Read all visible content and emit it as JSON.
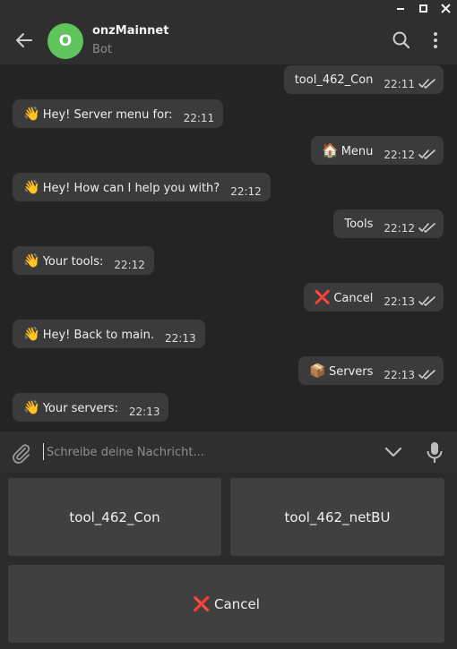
{
  "window": {
    "minimize_icon": "minimize-icon",
    "maximize_icon": "maximize-icon",
    "close_icon": "close-icon"
  },
  "header": {
    "avatar_letter": "O",
    "title": "onzMainnet",
    "subtitle": "Bot",
    "avatar_color": "#5fc45b"
  },
  "messages": [
    {
      "dir": "out",
      "emoji": "",
      "text": "tool_462_Con",
      "time": "22:11",
      "read": true
    },
    {
      "dir": "in",
      "emoji": "👋",
      "text": "Hey! Server menu for:",
      "time": "22:11"
    },
    {
      "dir": "out",
      "emoji": "🏠",
      "text": "Menu",
      "time": "22:12",
      "read": true
    },
    {
      "dir": "in",
      "emoji": "👋",
      "text": "Hey! How can I help you with?",
      "time": "22:12"
    },
    {
      "dir": "out",
      "emoji": "",
      "text": "Tools",
      "time": "22:12",
      "read": true
    },
    {
      "dir": "in",
      "emoji": "👋",
      "text": "Your tools:",
      "time": "22:12"
    },
    {
      "dir": "out",
      "emoji": "❌",
      "text": "Cancel",
      "time": "22:13",
      "read": true
    },
    {
      "dir": "in",
      "emoji": "👋",
      "text": "Hey! Back to main.",
      "time": "22:13"
    },
    {
      "dir": "out",
      "emoji": "📦",
      "text": "Servers",
      "time": "22:13",
      "read": true
    },
    {
      "dir": "in",
      "emoji": "👋",
      "text": "Your servers:",
      "time": "22:13"
    }
  ],
  "input": {
    "placeholder": "Schreibe deine Nachricht...",
    "value": ""
  },
  "keyboard": {
    "buttons": [
      {
        "emoji": "",
        "label": "tool_462_Con"
      },
      {
        "emoji": "",
        "label": "tool_462_netBU"
      },
      {
        "emoji": "❌",
        "label": "Cancel"
      }
    ]
  },
  "colors": {
    "background": "#242424",
    "header": "#2f2f2f",
    "bubble": "#3b3b3b",
    "keyboard_button": "#404040",
    "accent_avatar": "#5fc45b"
  }
}
